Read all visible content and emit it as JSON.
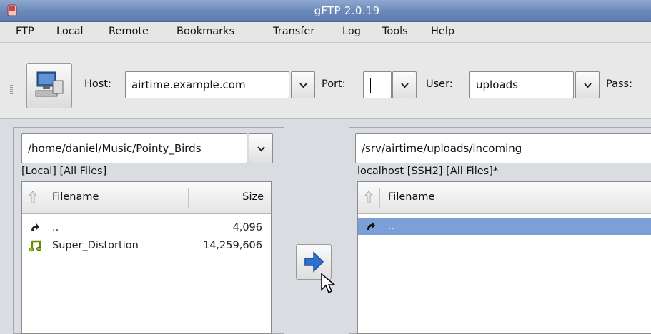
{
  "window": {
    "title": "gFTP 2.0.19"
  },
  "menubar": {
    "items": [
      "FTP",
      "Local",
      "Remote",
      "Bookmarks",
      "Transfer",
      "Log",
      "Tools",
      "Help"
    ]
  },
  "toolbar": {
    "host_label": "Host:",
    "host_value": "airtime.example.com",
    "port_label": "Port:",
    "port_value": "",
    "user_label": "User:",
    "user_value": "uploads",
    "pass_label": "Pass:"
  },
  "local": {
    "path": "/home/daniel/Music/Pointy_Birds",
    "status": "[Local] [All Files]",
    "col_filename": "Filename",
    "col_size": "Size",
    "rows": [
      {
        "name": "..",
        "size": "4,096",
        "icon": "parent-dir-arrow-icon"
      },
      {
        "name": "Super_Distortion",
        "size": "14,259,606",
        "icon": "music-note-icon"
      }
    ]
  },
  "remote": {
    "path": "/srv/airtime/uploads/incoming",
    "status": "localhost [SSH2] [All Files]*",
    "col_filename": "Filename",
    "rows": [
      {
        "name": "..",
        "icon": "parent-dir-arrow-icon",
        "selected": true
      }
    ]
  },
  "colors": {
    "titlebar": "#6a88b8",
    "selection": "#7b9fd6",
    "transfer_arrow": "#2f6fd0"
  }
}
